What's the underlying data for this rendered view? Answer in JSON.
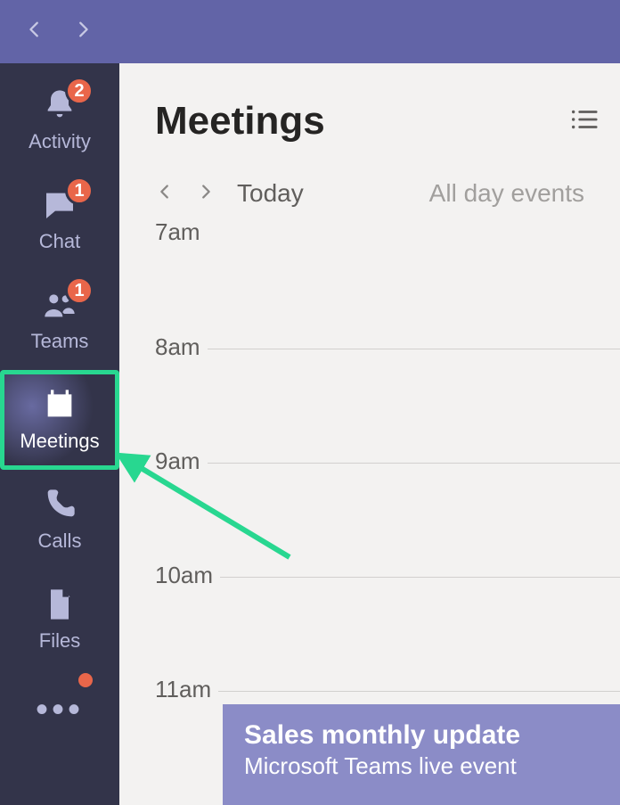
{
  "topbar": {},
  "rail": {
    "items": [
      {
        "label": "Activity",
        "badge": "2"
      },
      {
        "label": "Chat",
        "badge": "1"
      },
      {
        "label": "Teams",
        "badge": "1"
      },
      {
        "label": "Meetings"
      },
      {
        "label": "Calls"
      },
      {
        "label": "Files"
      }
    ]
  },
  "header": {
    "title": "Meetings"
  },
  "dayNav": {
    "today": "Today",
    "allDay": "All day events"
  },
  "timeline": {
    "hours": [
      "7am",
      "8am",
      "9am",
      "10am",
      "11am"
    ]
  },
  "event": {
    "title": "Sales monthly update",
    "subtitle": "Microsoft Teams live event"
  }
}
